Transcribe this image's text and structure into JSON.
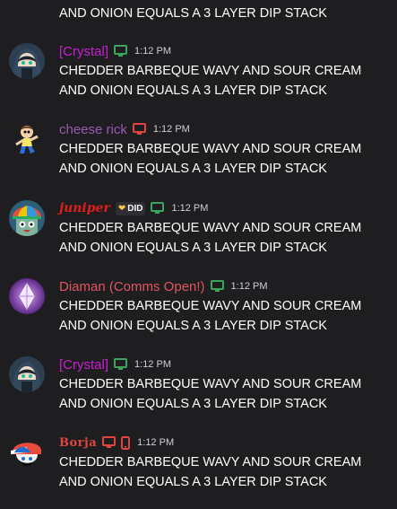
{
  "top_message": {
    "text": "AND ONION EQUALS A 3 LAYER DIP STACK"
  },
  "colors": {
    "background": "#1e1e20",
    "desktop_icon_green": "#3ba55d",
    "desktop_icon_red": "#e0453f",
    "mobile_icon_red": "#e0453f"
  },
  "messages": [
    {
      "username": "[Crystal]",
      "name_color": "#c91ed2",
      "status_icons": [
        "desktop-icon"
      ],
      "status_color": "#3ba55d",
      "timestamp": "1:12 PM",
      "line1": "CHEDDER BARBEQUE WAVY AND SOUR CREAM",
      "line2": "AND ONION EQUALS A 3 LAYER DIP STACK",
      "avatar": "hooded-anime-avatar"
    },
    {
      "username": "cheese rick",
      "name_color": "#9b59b6",
      "status_icons": [
        "desktop-icon"
      ],
      "status_color": "#e0453f",
      "timestamp": "1:12 PM",
      "line1": "CHEDDER BARBEQUE WAVY AND SOUR CREAM",
      "line2": "AND ONION EQUALS A 3 LAYER DIP STACK",
      "avatar": "morty-avatar"
    },
    {
      "username": "juniper",
      "name_color": "#e31d1d",
      "badge": "DID",
      "status_icons": [
        "desktop-icon"
      ],
      "status_color": "#3ba55d",
      "timestamp": "1:12 PM",
      "line1": "CHEDDER BARBEQUE WAVY AND SOUR CREAM",
      "line2": "AND ONION EQUALS A 3 LAYER DIP STACK",
      "avatar": "rainbow-hat-avatar"
    },
    {
      "username": "Diaman (Comms Open!)",
      "name_color": "#e05560",
      "status_icons": [
        "desktop-icon"
      ],
      "status_color": "#3ba55d",
      "timestamp": "1:12 PM",
      "line1": "CHEDDER BARBEQUE WAVY AND SOUR CREAM",
      "line2": "AND ONION EQUALS A 3 LAYER DIP STACK",
      "avatar": "crystal-gem-avatar"
    },
    {
      "username": "[Crystal]",
      "name_color": "#c91ed2",
      "status_icons": [
        "desktop-icon"
      ],
      "status_color": "#3ba55d",
      "timestamp": "1:12 PM",
      "line1": "CHEDDER BARBEQUE WAVY AND SOUR CREAM",
      "line2": "AND ONION EQUALS A 3 LAYER DIP STACK",
      "avatar": "hooded-anime-avatar"
    },
    {
      "username": "Borja",
      "name_color": "#e0453f",
      "status_icons": [
        "desktop-icon",
        "mobile-icon"
      ],
      "status_color": "#e0453f",
      "timestamp": "1:12 PM",
      "line1": "CHEDDER BARBEQUE WAVY AND SOUR CREAM",
      "line2": "AND ONION EQUALS A 3 LAYER DIP STACK",
      "avatar": "boyfriend-avatar"
    }
  ]
}
